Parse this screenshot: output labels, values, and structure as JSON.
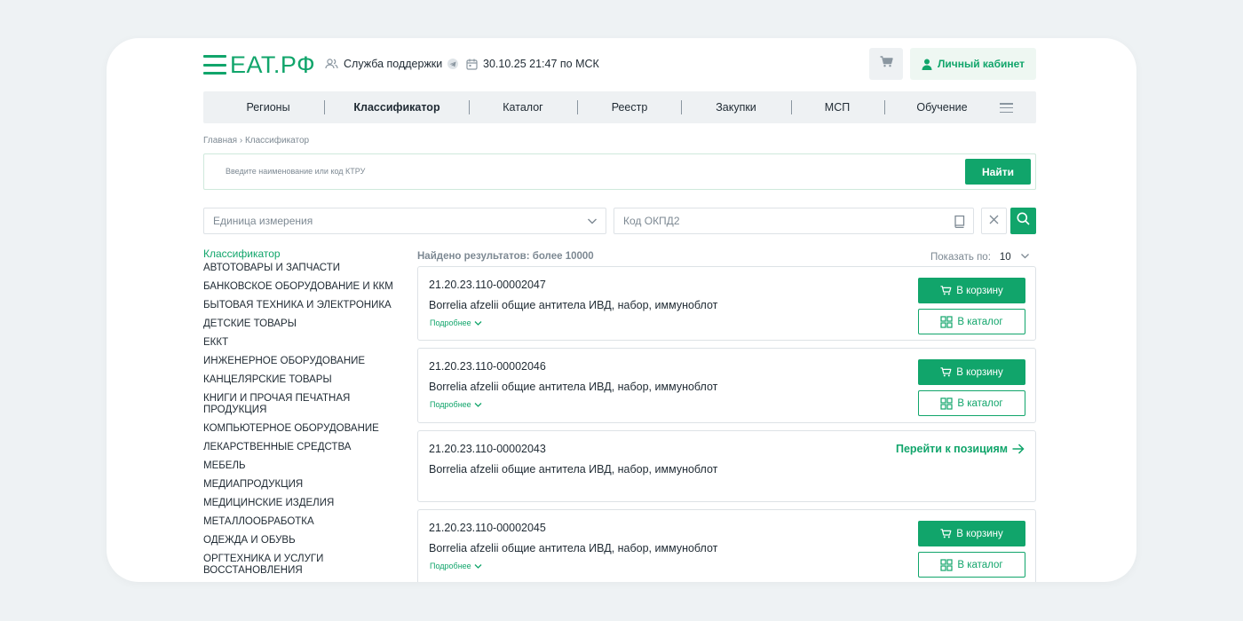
{
  "header": {
    "logo": "ЕАТ.РФ",
    "support": "Служба поддержки",
    "datetime": "30.10.25 21:47 по МСК",
    "cabinet": "Личный кабинет"
  },
  "nav": {
    "items": [
      "Регионы",
      "Классификатор",
      "Каталог",
      "Реестр",
      "Закупки",
      "МСП",
      "Обучение"
    ],
    "active": "Классификатор"
  },
  "breadcrumb": "Главная › Классификатор",
  "search": {
    "placeholder": "Введите наименование или код КТРУ",
    "button": "Найти"
  },
  "filters": {
    "unit_placeholder": "Единица измерения",
    "okpd_placeholder": "Код ОКПД2"
  },
  "sidebar": {
    "title": "Классификатор",
    "items": [
      "АВТОТОВАРЫ И ЗАПЧАСТИ",
      "БАНКОВСКОЕ ОБОРУДОВАНИЕ И ККМ",
      "БЫТОВАЯ ТЕХНИКА И ЭЛЕКТРОНИКА",
      "ДЕТСКИЕ ТОВАРЫ",
      "ЕККТ",
      "ИНЖЕНЕРНОЕ ОБОРУДОВАНИЕ",
      "КАНЦЕЛЯРСКИЕ ТОВАРЫ",
      "КНИГИ И ПРОЧАЯ ПЕЧАТНАЯ ПРОДУКЦИЯ",
      "КОМПЬЮТЕРНОЕ ОБОРУДОВАНИЕ",
      "ЛЕКАРСТВЕННЫЕ СРЕДСТВА",
      "МЕБЕЛЬ",
      "МЕДИАПРОДУКЦИЯ",
      "МЕДИЦИНСКИЕ ИЗДЕЛИЯ",
      "МЕТАЛЛООБРАБОТКА",
      "ОДЕЖДА И ОБУВЬ",
      "ОРГТЕХНИКА И УСЛУГИ ВОССТАНОВЛЕНИЯ"
    ]
  },
  "results": {
    "found": "Найдено результатов: более 10000",
    "per_page_label": "Показать по:",
    "per_page_value": "10",
    "more_label": "Подробнее",
    "cart_label": "В корзину",
    "catalog_label": "В каталог",
    "goto_label": "Перейти к позициям",
    "items": [
      {
        "code": "21.20.23.110-00002047",
        "name": "Borrelia afzelii общие антитела ИВД, набор, иммуноблот"
      },
      {
        "code": "21.20.23.110-00002046",
        "name": "Borrelia afzelii общие антитела ИВД, набор, иммуноблот"
      },
      {
        "code": "21.20.23.110-00002043",
        "name": "Borrelia afzelii общие антитела ИВД, набор, иммуноблот"
      },
      {
        "code": "21.20.23.110-00002045",
        "name": "Borrelia afzelii общие антитела ИВД, набор, иммуноблот"
      }
    ]
  },
  "colors": {
    "accent": "#11a56b",
    "background": "#eef2f4",
    "nav_bg": "#eef1f3"
  }
}
